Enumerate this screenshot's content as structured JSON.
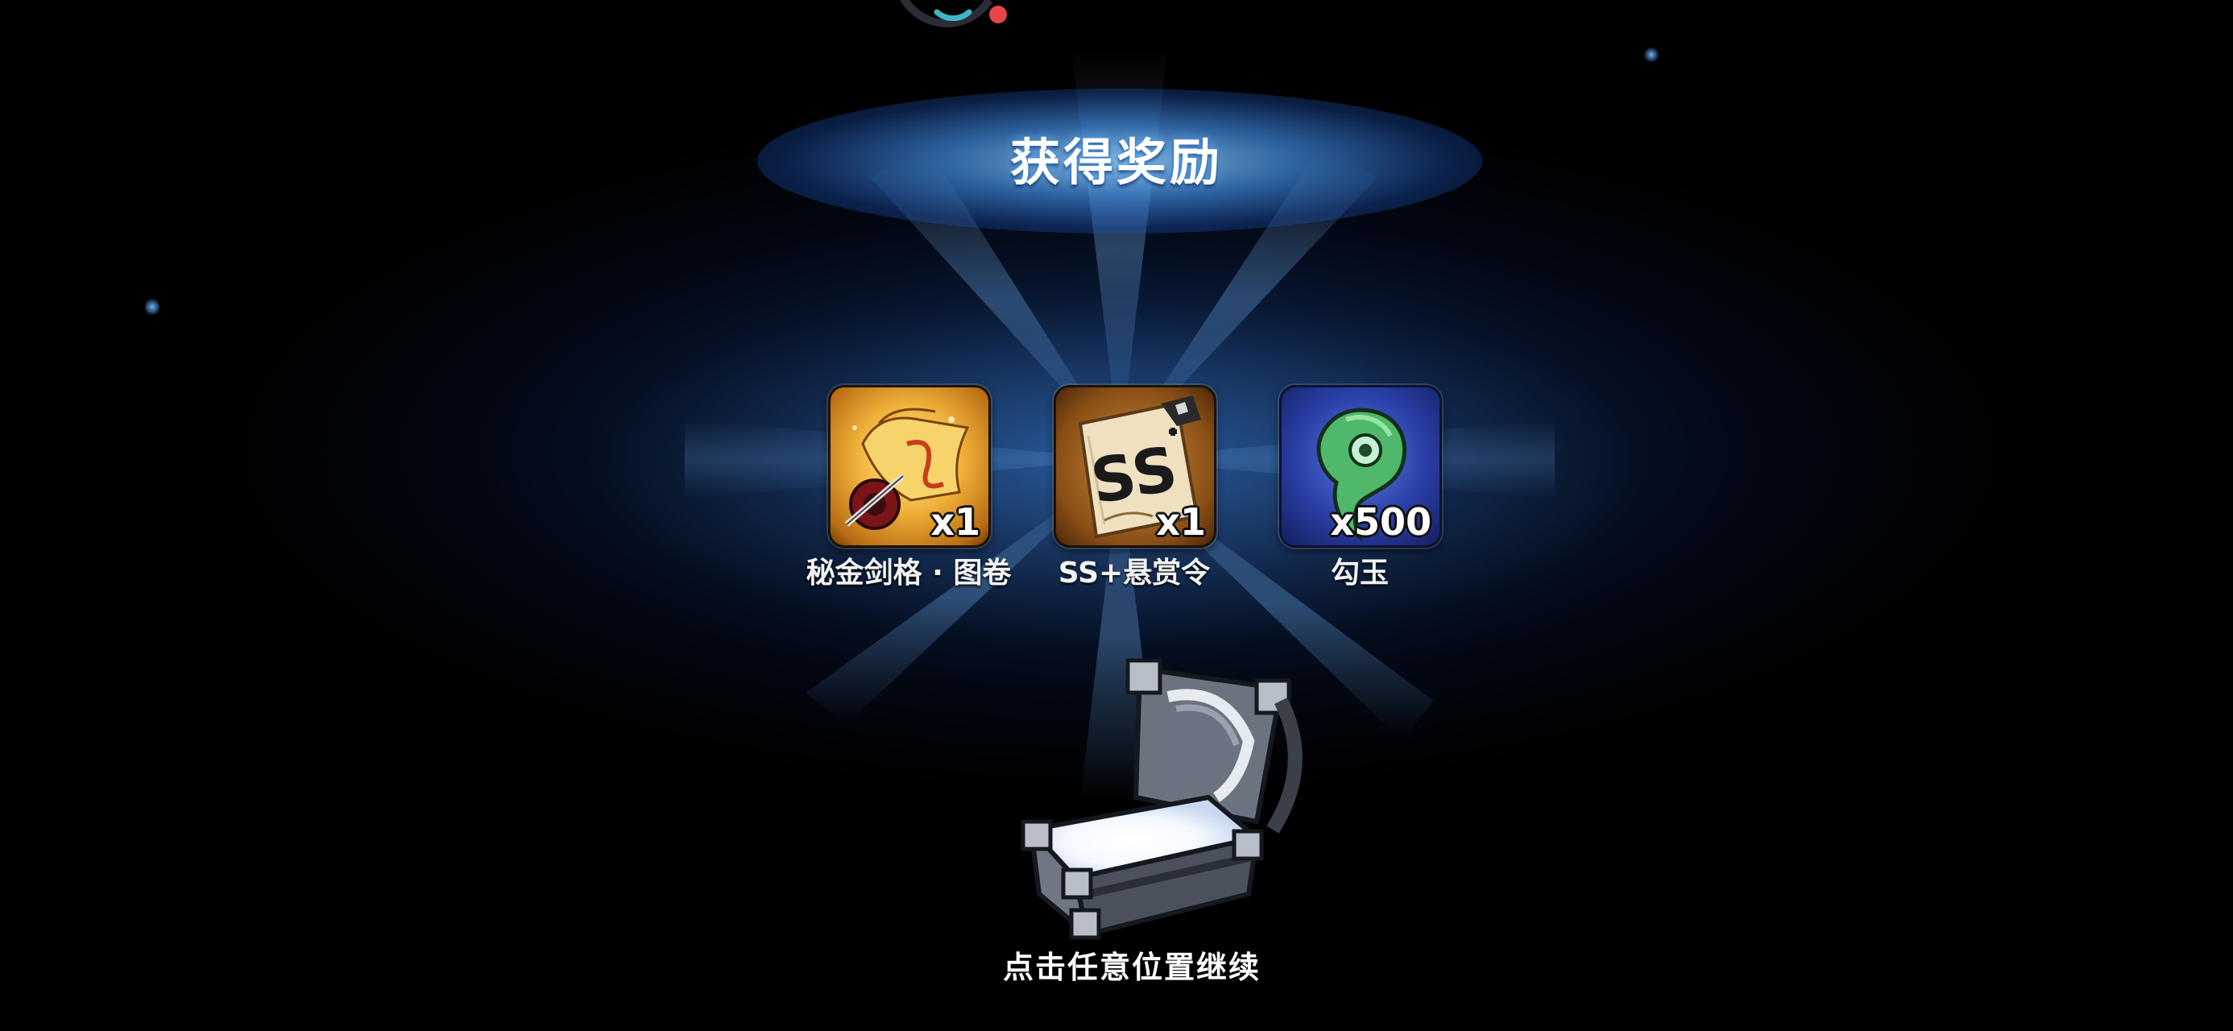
{
  "title": "获得奖励",
  "rewards": [
    {
      "name": "秘金剑格 · 图卷",
      "count": "x1",
      "icon": "golden-scroll-icon"
    },
    {
      "name": "SS+悬赏令",
      "count": "x1",
      "icon": "bounty-order-icon"
    },
    {
      "name": "勾玉",
      "count": "x500",
      "icon": "magatama-icon"
    }
  ],
  "continue_hint": "点击任意位置继续",
  "decor": {
    "chest_icon": "open-treasure-chest-icon",
    "loading_icon": "loading-ring-icon"
  },
  "colors": {
    "background": "#000000",
    "glow": "#3a8ce0",
    "text": "#ffffff",
    "status_dot": "#e8454a"
  }
}
